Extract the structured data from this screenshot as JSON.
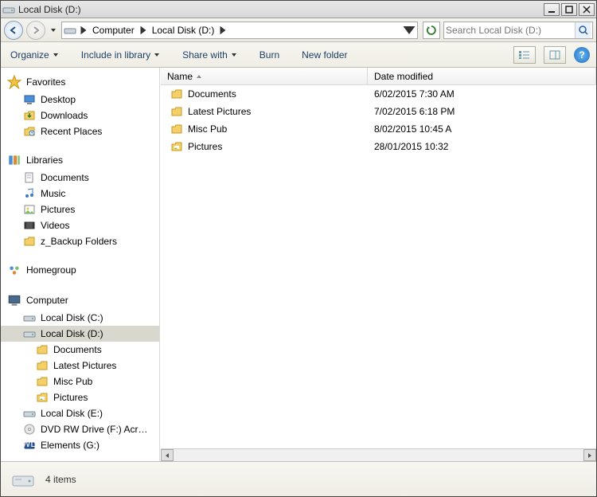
{
  "title": "Local Disk (D:)",
  "breadcrumb": {
    "seg1": "Computer",
    "seg2": "Local Disk (D:)"
  },
  "search": {
    "placeholder": "Search Local Disk (D:)"
  },
  "toolbar": {
    "organize": "Organize",
    "include": "Include in library",
    "share": "Share with",
    "burn": "Burn",
    "newfolder": "New folder"
  },
  "nav": {
    "favorites": {
      "label": "Favorites",
      "items": [
        "Desktop",
        "Downloads",
        "Recent Places"
      ]
    },
    "libraries": {
      "label": "Libraries",
      "items": [
        "Documents",
        "Music",
        "Pictures",
        "Videos",
        "z_Backup Folders"
      ]
    },
    "homegroup": "Homegroup",
    "computer": {
      "label": "Computer",
      "drives": [
        {
          "label": "Local Disk (C:)",
          "children": []
        },
        {
          "label": "Local Disk (D:)",
          "selected": true,
          "children": [
            "Documents",
            "Latest Pictures",
            "Misc Pub",
            "Pictures"
          ]
        },
        {
          "label": "Local Disk (E:)",
          "children": []
        },
        {
          "label": "DVD RW Drive (F:) Acronis Media",
          "children": []
        },
        {
          "label": "Elements (G:)",
          "children": []
        }
      ]
    }
  },
  "columns": {
    "name": "Name",
    "date": "Date modified"
  },
  "files": [
    {
      "name": "Documents",
      "date": "6/02/2015 7:30 AM",
      "icon": "folder"
    },
    {
      "name": "Latest Pictures",
      "date": "7/02/2015 6:18 PM",
      "icon": "folder"
    },
    {
      "name": "Misc Pub",
      "date": "8/02/2015 10:45 A",
      "icon": "folder"
    },
    {
      "name": "Pictures",
      "date": "28/01/2015 10:32",
      "icon": "folder-pic"
    }
  ],
  "status": {
    "count": "4 items"
  }
}
